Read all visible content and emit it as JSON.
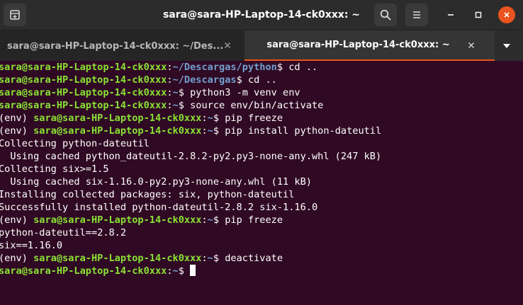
{
  "window": {
    "title": "sara@sara-HP-Laptop-14-ck0xxx: ~"
  },
  "tabs": [
    {
      "label": "sara@sara-HP-Laptop-14-ck0xxx: ~/Des...",
      "active": false
    },
    {
      "label": "sara@sara-HP-Laptop-14-ck0xxx: ~",
      "active": true
    }
  ],
  "colors": {
    "background": "#300a24",
    "user_host": "#8ae234",
    "path": "#729fcf",
    "text": "#ffffff",
    "accent": "#e95420"
  },
  "icons": {
    "new_tab": "new-tab-icon",
    "search": "search-icon",
    "menu": "hamburger-menu-icon",
    "minimize": "minimize-icon",
    "maximize": "maximize-icon",
    "close": "close-icon",
    "tab_close": "close-icon",
    "tab_list": "chevron-down-icon"
  },
  "terminal": {
    "lines": [
      {
        "env": "",
        "user": "sara@sara-HP-Laptop-14-ck0xxx",
        "sep": ":",
        "path": "~/Descargas/python",
        "sym": "$ ",
        "cmd": "cd .."
      },
      {
        "env": "",
        "user": "sara@sara-HP-Laptop-14-ck0xxx",
        "sep": ":",
        "path": "~/Descargas",
        "sym": "$ ",
        "cmd": "cd .."
      },
      {
        "env": "",
        "user": "sara@sara-HP-Laptop-14-ck0xxx",
        "sep": ":",
        "path": "~",
        "sym": "$ ",
        "cmd": "python3 -m venv env"
      },
      {
        "env": "",
        "user": "sara@sara-HP-Laptop-14-ck0xxx",
        "sep": ":",
        "path": "~",
        "sym": "$ ",
        "cmd": "source env/bin/activate"
      },
      {
        "env": "(env) ",
        "user": "sara@sara-HP-Laptop-14-ck0xxx",
        "sep": ":",
        "path": "~",
        "sym": "$ ",
        "cmd": "pip freeze"
      },
      {
        "env": "(env) ",
        "user": "sara@sara-HP-Laptop-14-ck0xxx",
        "sep": ":",
        "path": "~",
        "sym": "$ ",
        "cmd": "pip install python-dateutil"
      },
      {
        "out": "Collecting python-dateutil"
      },
      {
        "out": "  Using cached python_dateutil-2.8.2-py2.py3-none-any.whl (247 kB)"
      },
      {
        "out": "Collecting six>=1.5"
      },
      {
        "out": "  Using cached six-1.16.0-py2.py3-none-any.whl (11 kB)"
      },
      {
        "out": "Installing collected packages: six, python-dateutil"
      },
      {
        "out": "Successfully installed python-dateutil-2.8.2 six-1.16.0"
      },
      {
        "env": "(env) ",
        "user": "sara@sara-HP-Laptop-14-ck0xxx",
        "sep": ":",
        "path": "~",
        "sym": "$ ",
        "cmd": "pip freeze"
      },
      {
        "out": "python-dateutil==2.8.2"
      },
      {
        "out": "six==1.16.0"
      },
      {
        "env": "(env) ",
        "user": "sara@sara-HP-Laptop-14-ck0xxx",
        "sep": ":",
        "path": "~",
        "sym": "$ ",
        "cmd": "deactivate"
      },
      {
        "env": "",
        "user": "sara@sara-HP-Laptop-14-ck0xxx",
        "sep": ":",
        "path": "~",
        "sym": "$ ",
        "cmd": "",
        "cursor": true
      }
    ]
  }
}
